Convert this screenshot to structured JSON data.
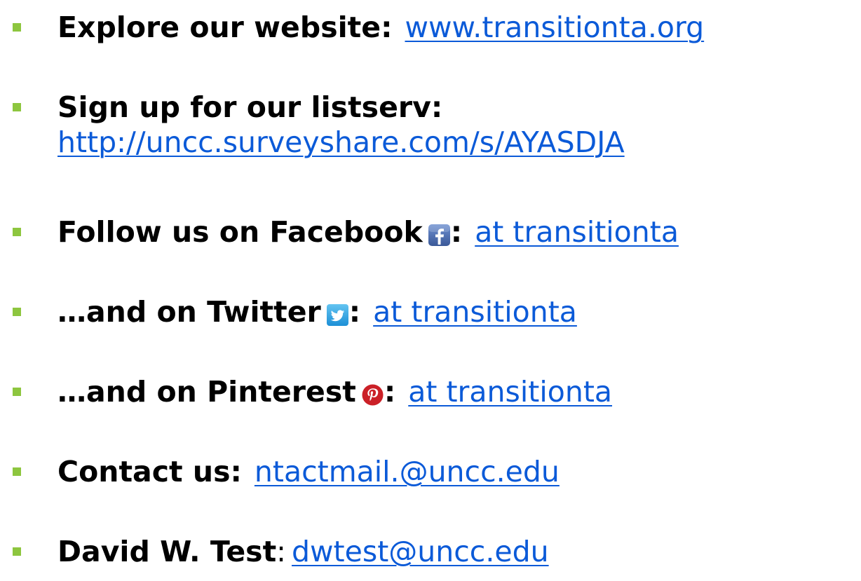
{
  "theme": {
    "bullet_color": "#8dc63f",
    "link_color": "#0b5ad8"
  },
  "items": [
    {
      "label": "Explore our website:",
      "link": "www.transitionta.org"
    },
    {
      "label": "Sign up for our listserv:",
      "link": "http://uncc.surveyshare.com/s/AYASDJA"
    },
    {
      "label": "Follow us on Facebook",
      "icon": "facebook-icon",
      "separator": ":",
      "link": "at transitionta"
    },
    {
      "label": "…and on Twitter",
      "icon": "twitter-icon",
      "separator": ":",
      "link": "at transitionta"
    },
    {
      "label": "…and on Pinterest",
      "icon": "pinterest-icon",
      "separator": ":",
      "link": "at transitionta"
    },
    {
      "label": "Contact us:",
      "link": "ntactmail.@uncc.edu"
    },
    {
      "label": "David W. Test",
      "separator": ":",
      "link": "dwtest@uncc.edu"
    }
  ]
}
